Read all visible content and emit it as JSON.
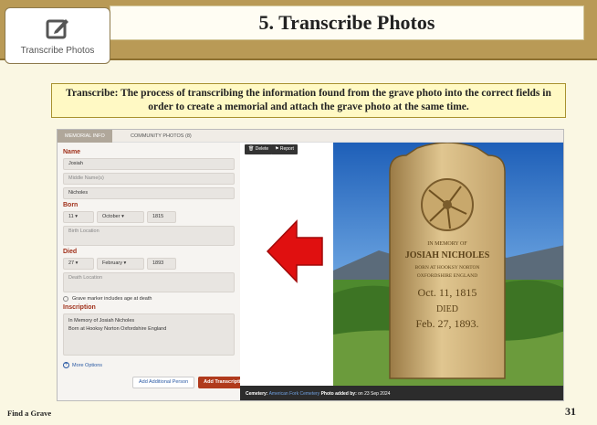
{
  "slide": {
    "title": "5. Transcribe Photos",
    "logo_label": "Transcribe Photos",
    "definition": "Transcribe: The process of transcribing the information found from the grave photo into the correct fields in order to create a memorial and attach the grave photo at the same time.",
    "footer_left": "Find a Grave",
    "page_number": "31"
  },
  "screenshot": {
    "tabs": [
      "MEMORIAL INFO",
      "COMMUNITY PHOTOS (8)"
    ],
    "labels": {
      "name": "Name",
      "born": "Born",
      "died": "Died",
      "inscription": "Inscription"
    },
    "fields": {
      "first_name": "Josiah",
      "middle_name_placeholder": "Middle Name(s)",
      "last_name": "Nicholes",
      "born_day": "11",
      "born_month": "October",
      "born_year": "1815",
      "birth_location_placeholder": "Birth Location",
      "died_day": "27",
      "died_month": "February",
      "died_year": "1893",
      "death_location_placeholder": "Death Location",
      "inscription_text": "In Memory of Josiah Nicholes\nBorn at Hooksy Norton Oxfordshire England"
    },
    "checkbox_label": "Grave marker includes age at death",
    "more_options": "More Options",
    "add_person_button": "Add Additional Person",
    "add_transcription_button": "Add Transcription",
    "delete_button": "Delete",
    "report_button": "Report",
    "caption": {
      "cemetery_label": "Cemetery:",
      "cemetery_value": "American Fork Cemetery",
      "added_by_label": "Photo added by:",
      "date": "on 23 Sep 2024"
    },
    "headstone_text": [
      "IN MEMORY OF",
      "JOSIAH NICHOLES",
      "BORN AT HOOKSY NORTON",
      "OXFORDSHIRE ENGLAND",
      "Oct. 11, 1815",
      "DIED",
      "Feb. 27, 1893."
    ]
  },
  "colors": {
    "header_band": "#b99a56",
    "slide_bg": "#faf7e3",
    "definition_bg": "#fff9c4",
    "accent_red": "#b03a1c",
    "arrow_red": "#e01010"
  },
  "icons": [
    "transcribe-icon",
    "red-arrow-icon",
    "trash-icon",
    "flag-icon",
    "plus-circle-icon",
    "chevron-down-icon"
  ]
}
